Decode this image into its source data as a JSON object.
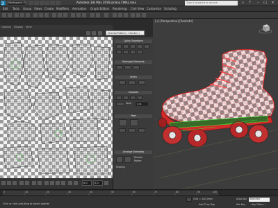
{
  "titlebar": {
    "workspace": "Workspace: Default",
    "title": "Autodesk 3ds Max 2016     jorlano FINAL.max",
    "search_placeholder": "Type a keyword or phrase"
  },
  "menubar": {
    "items": [
      "Edit",
      "Tools",
      "Group",
      "Views",
      "Create",
      "Modifiers",
      "Animation",
      "Graph Editors",
      "Rendering",
      "Civil View",
      "Customize",
      "Scripting"
    ]
  },
  "uv_editor": {
    "menu": [
      "Options",
      "Display",
      "View"
    ],
    "checker_pattern": "CheckerPattern  ( Checker )",
    "zoom_field": "0.0",
    "w_field": "0.0"
  },
  "unwrap_panel": {
    "sections": [
      "Quick Transform",
      "Reshape Elements",
      "Stitch",
      "Explode",
      "Peel",
      "Arrange Elements"
    ],
    "weld_label": "Weld",
    "threshold": "0.01",
    "padding": "Padding",
    "rescale": "Rescale",
    "rotate": "Rotate"
  },
  "viewport": {
    "label": "[+] [Perspective] [Realistic]"
  },
  "timeline": {
    "ticks": [
      "0",
      "10",
      "20",
      "30",
      "40",
      "50",
      "60",
      "70",
      "80",
      "90",
      "100"
    ]
  },
  "statusbar": {
    "prompt": "Click or click-and-drag to select objects",
    "grid": "Grid = 100,0mm",
    "add_time_tag": "Add Time Tag",
    "auto_key": "Auto Key",
    "selected": "Selected",
    "set_key": "Set Key",
    "key_filters": "Key Filters..."
  },
  "colors": {
    "shoe_red": "#e8282a",
    "checker_dark": "#9a9a9a",
    "checker_light": "#f4f4f4",
    "wire_green": "#33ff33"
  }
}
